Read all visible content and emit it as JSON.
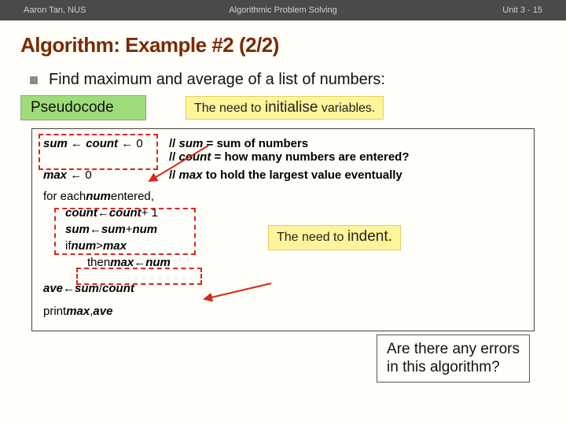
{
  "topbar": {
    "left": "Aaron Tan, NUS",
    "center": "Algorithmic Problem Solving",
    "right": "Unit 3 - 15"
  },
  "title": "Algorithm: Example #2 (2/2)",
  "bullet": "Find maximum and average of a list of numbers:",
  "pseudo_label": "Pseudocode",
  "callout_init_prefix": "The need to ",
  "callout_init_big": "initialise",
  "callout_init_suffix": " variables.",
  "code": {
    "r1_left_a": "sum",
    "r1_left_b": "count",
    "r1_zero": "0",
    "r1_c1a": "// ",
    "r1_c1b": "sum",
    "r1_c1c": " = sum of numbers",
    "r1_c2a": "// ",
    "r1_c2b": "count",
    "r1_c2c": " = how many numbers are entered?",
    "r2_left": "max",
    "r2_zero": "0",
    "r2_c1a": "// ",
    "r2_c1b": "max",
    "r2_c1c": " to hold the largest value eventually",
    "r3_a": "for each ",
    "r3_b": "num",
    "r3_c": " entered,",
    "r4_a": "count",
    "r4_b": "count",
    "r4_c": " + 1",
    "r5_a": "sum",
    "r5_b": "sum",
    "r5_c": " + ",
    "r5_d": "num",
    "r6_a": "if ",
    "r6_b": "num",
    "r6_c": " > ",
    "r6_d": "max",
    "r7_a": "then ",
    "r7_b": "max",
    "r7_d": "num",
    "r8_a": "ave",
    "r8_b": "sum",
    "r8_c": " / ",
    "r8_d": "count",
    "r9_a": "print ",
    "r9_b": "max",
    "r9_c": ", ",
    "r9_d": "ave"
  },
  "callout_indent_prefix": "The need to ",
  "callout_indent_big": "indent.",
  "question_l1": "Are there any errors",
  "question_l2": "in this algorithm?",
  "arrow_glyph": " ← "
}
